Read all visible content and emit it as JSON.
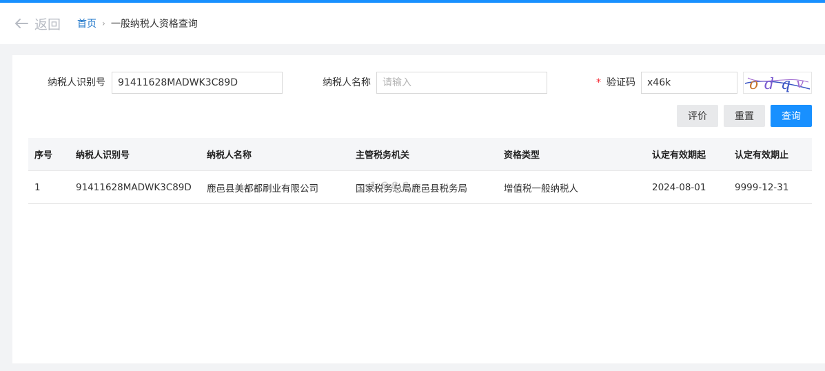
{
  "header": {
    "back_label": "返回",
    "breadcrumb": {
      "home": "首页",
      "separator": "›",
      "current": "一般纳税人资格查询"
    }
  },
  "form": {
    "taxpayer_id_label": "纳税人识别号",
    "taxpayer_id_value": "91411628MADWK3C89D",
    "taxpayer_name_label": "纳税人名称",
    "taxpayer_name_placeholder": "请输入",
    "captcha_required_mark": "*",
    "captcha_label": "验证码",
    "captcha_value": "x46k",
    "captcha_image_text": "odqv"
  },
  "buttons": {
    "rate": "评价",
    "reset": "重置",
    "query": "查询"
  },
  "table": {
    "columns": [
      "序号",
      "纳税人识别号",
      "纳税人名称",
      "主管税务机关",
      "资格类型",
      "认定有效期起",
      "认定有效期止"
    ],
    "rows": [
      [
        "1",
        "91411628MADWK3C89D",
        "鹿邑县美都都刷业有限公司",
        "国家税务总局鹿邑县税务局",
        "增值税一般纳税人",
        "2024-08-01",
        "9999-12-31"
      ]
    ],
    "watermark": "1688"
  },
  "colors": {
    "accent": "#1890ff",
    "link": "#1a73c8",
    "required": "#f5222d"
  }
}
